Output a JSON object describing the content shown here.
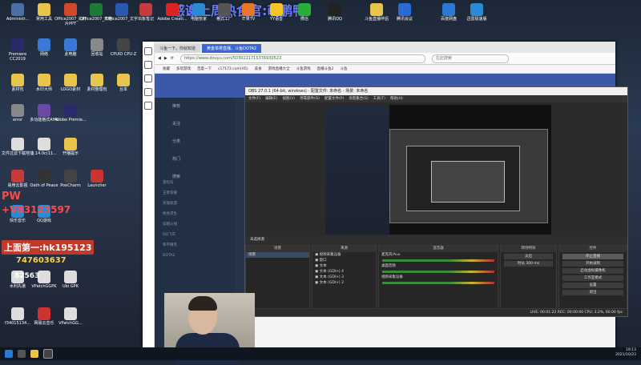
{
  "overlay": {
    "title": "感谢上周热食官:萌鹏鸭",
    "promo_pw": "PW",
    "promo_vx": "+V83123597",
    "promo_group": "上面第一:hk195123",
    "promo_qq": "747603637",
    "promo_num": "82563"
  },
  "desktop_icons": [
    {
      "label": "Administr...",
      "color": "#4a6fa5"
    },
    {
      "label": "常用工具",
      "color": "#e8c54a"
    },
    {
      "label": "Office2007_幻灯片PPT",
      "color": "#d04a2a"
    },
    {
      "label": "Office2007_表格",
      "color": "#1f7a3a"
    },
    {
      "label": "Office2007_文字",
      "color": "#2a5ab0"
    },
    {
      "label": "出象笔记",
      "color": "#c63b3b"
    },
    {
      "label": "Adobe Creati...",
      "color": "#d22"
    },
    {
      "label": "电脑管家",
      "color": "#2a8ad4"
    },
    {
      "label": "格式工厂",
      "color": "#555"
    },
    {
      "label": "芒果TV",
      "color": "#e8762a"
    },
    {
      "label": "YY语音",
      "color": "#f3c623"
    },
    {
      "label": "微信",
      "color": "#2aae3a"
    },
    {
      "label": "腾讯QQ",
      "color": "#222"
    },
    {
      "label": "斗鱼直播伴侣",
      "color": "#e8c54a"
    },
    {
      "label": "腾讯会议",
      "color": "#2a6ad4"
    },
    {
      "label": "百度网盘",
      "color": "#2a7ad4"
    },
    {
      "label": "迅雷极速版",
      "color": "#2a8ad4"
    },
    {
      "label": "Premiere CC2019",
      "color": "#2a2a6a"
    },
    {
      "label": "网络",
      "color": "#3a7ad4"
    },
    {
      "label": "此电脑",
      "color": "#3a7ad4"
    },
    {
      "label": "回收站",
      "color": "#888"
    },
    {
      "label": "CPUID CPU-Z",
      "color": "#444"
    },
    {
      "label": "素材包",
      "color": "#e8c54a"
    },
    {
      "label": "水印大师",
      "color": "#e8c54a"
    },
    {
      "label": "LOGO素材",
      "color": "#e8c54a"
    },
    {
      "label": "素材整理包",
      "color": "#e8c54a"
    },
    {
      "label": "台本",
      "color": "#e8c54a"
    },
    {
      "label": "error",
      "color": "#888"
    },
    {
      "label": "多功能格式AHK",
      "color": "#6a4aa5"
    },
    {
      "label": "Adobe Premie...",
      "color": "#2a2a6a"
    },
    {
      "label": "文件过滤下载地址",
      "color": "#ddd"
    },
    {
      "label": "3.14.0c(11...",
      "color": "#ddd"
    },
    {
      "label": "开播提示",
      "color": "#e8c54a"
    },
    {
      "label": "易用云影视",
      "color": "#c63b3b"
    },
    {
      "label": "Oath of Peace",
      "color": "#333"
    },
    {
      "label": "PoeCharm",
      "color": "#444"
    },
    {
      "label": "Launcher",
      "color": "#c33"
    },
    {
      "label": "快乐音乐",
      "color": "#2a8ad4"
    },
    {
      "label": "QQ游戏",
      "color": "#2a8ad4"
    },
    {
      "label": "水利先遣",
      "color": "#ddd"
    },
    {
      "label": "VPatchGGPK",
      "color": "#ddd"
    },
    {
      "label": "Ubi GPK",
      "color": "#ddd"
    },
    {
      "label": "f34015134...",
      "color": "#ddd"
    },
    {
      "label": "网易云音乐",
      "color": "#c33"
    },
    {
      "label": "VPatchGG...",
      "color": "#ddd"
    }
  ],
  "browser": {
    "tab_label": "斗鱼一下，你就知道",
    "tab_active": "黄金单排直播，斗鱼DOTA2",
    "url": "https://www.douyu.com/5030221715376930522",
    "search_placeholder": "在此搜索",
    "bookmarks": [
      "收藏",
      "多玩游戏",
      "百度一下",
      "c17173.com(H5)",
      "美食",
      "游戏直播大全",
      "斗鱼游戏",
      "直播斗鱼2",
      "斗鱼"
    ],
    "left_menu": [
      "推荐",
      "关注",
      "分类",
      "热门",
      "搜索"
    ],
    "list_items": [
      "冒险岛",
      "王者荣耀",
      "英雄联盟",
      "绝地求生",
      "穿越火线",
      "QQ飞车",
      "和平精英",
      "DOTA2"
    ]
  },
  "obs": {
    "title": "OBS 27.0.1 (64-bit, windows) - 配置文件: 未命名 - 场景: 未命名",
    "menu": [
      "文件(F)",
      "编辑(E)",
      "视图(V)",
      "停靠部件(D)",
      "配置文件(P)",
      "场景集合(S)",
      "工具(T)",
      "帮助(H)"
    ],
    "source_bar": "未选择源",
    "docks": {
      "scenes": {
        "title": "场景",
        "items": [
          "场景"
        ]
      },
      "sources": {
        "title": "来源",
        "items": [
          "视频采集设备",
          "窗口",
          "文本",
          "文本 (GDI+) 4",
          "文本 (GDI+) 3",
          "文本 (GDI+) 2"
        ]
      },
      "mixer": {
        "title": "混音器",
        "items": [
          "麦克风/Aux",
          "桌面音频",
          "视频采集设备"
        ]
      },
      "transitions": {
        "title": "转场特效",
        "items": [
          "淡出",
          "时长 300 ms"
        ]
      },
      "controls": {
        "title": "控件",
        "items": [
          "停止直播",
          "开始录制",
          "启动虚拟摄像机",
          "工作室模式",
          "设置",
          "退出"
        ]
      }
    },
    "status": "LIVE: 00:01:22   REC: 00:00:00   CPU: 3.2%, 60.00 fps"
  },
  "taskbar": {
    "time": "19:13",
    "date": "2021/10/23"
  }
}
